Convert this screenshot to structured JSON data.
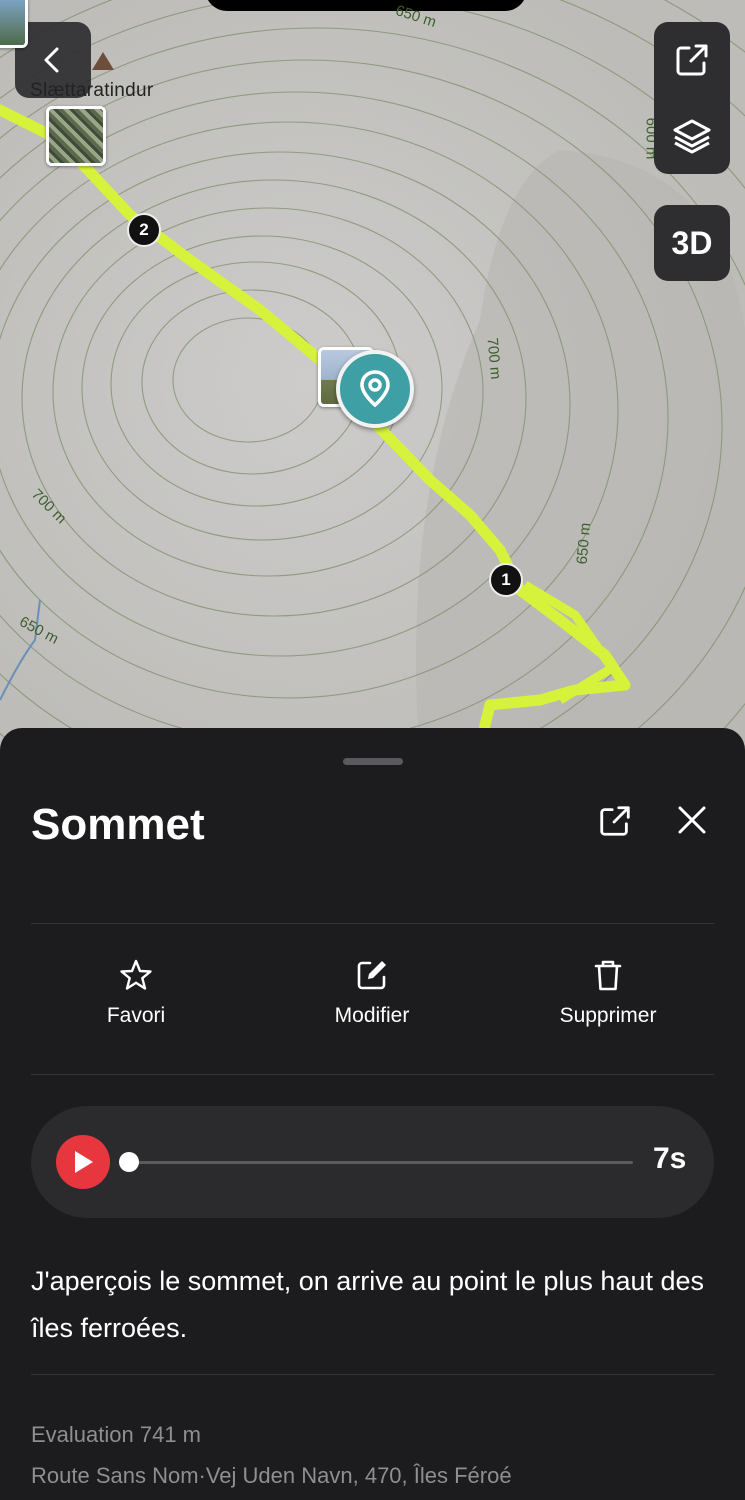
{
  "map": {
    "peak_label": "Slættaratindur",
    "elevation_labels": [
      "650 m",
      "600 m",
      "700 m",
      "650 m",
      "700 m",
      "650 m"
    ],
    "waypoints": [
      "2",
      "1"
    ],
    "button_3d": "3D",
    "route_color": "#d6f23a",
    "pin_color": "#3ea0a4",
    "icons": {
      "back": "chevron-left-icon",
      "share": "share-icon",
      "layers": "layers-icon",
      "pin": "location-pin-icon",
      "peak": "mountain-peak-icon"
    }
  },
  "sheet": {
    "title": "Sommet",
    "actions": [
      {
        "label": "Favori",
        "icon": "star-icon"
      },
      {
        "label": "Modifier",
        "icon": "edit-icon"
      },
      {
        "label": "Supprimer",
        "icon": "trash-icon"
      }
    ],
    "audio": {
      "duration": "7s",
      "progress": 0,
      "play_color": "#e8363f"
    },
    "description": "J'aperçois le sommet, on arrive au point le plus haut des îles ferroées.",
    "elevation": "Evaluation 741 m",
    "address": "Route Sans Nom·Vej Uden Navn, 470, Îles Féroé"
  }
}
